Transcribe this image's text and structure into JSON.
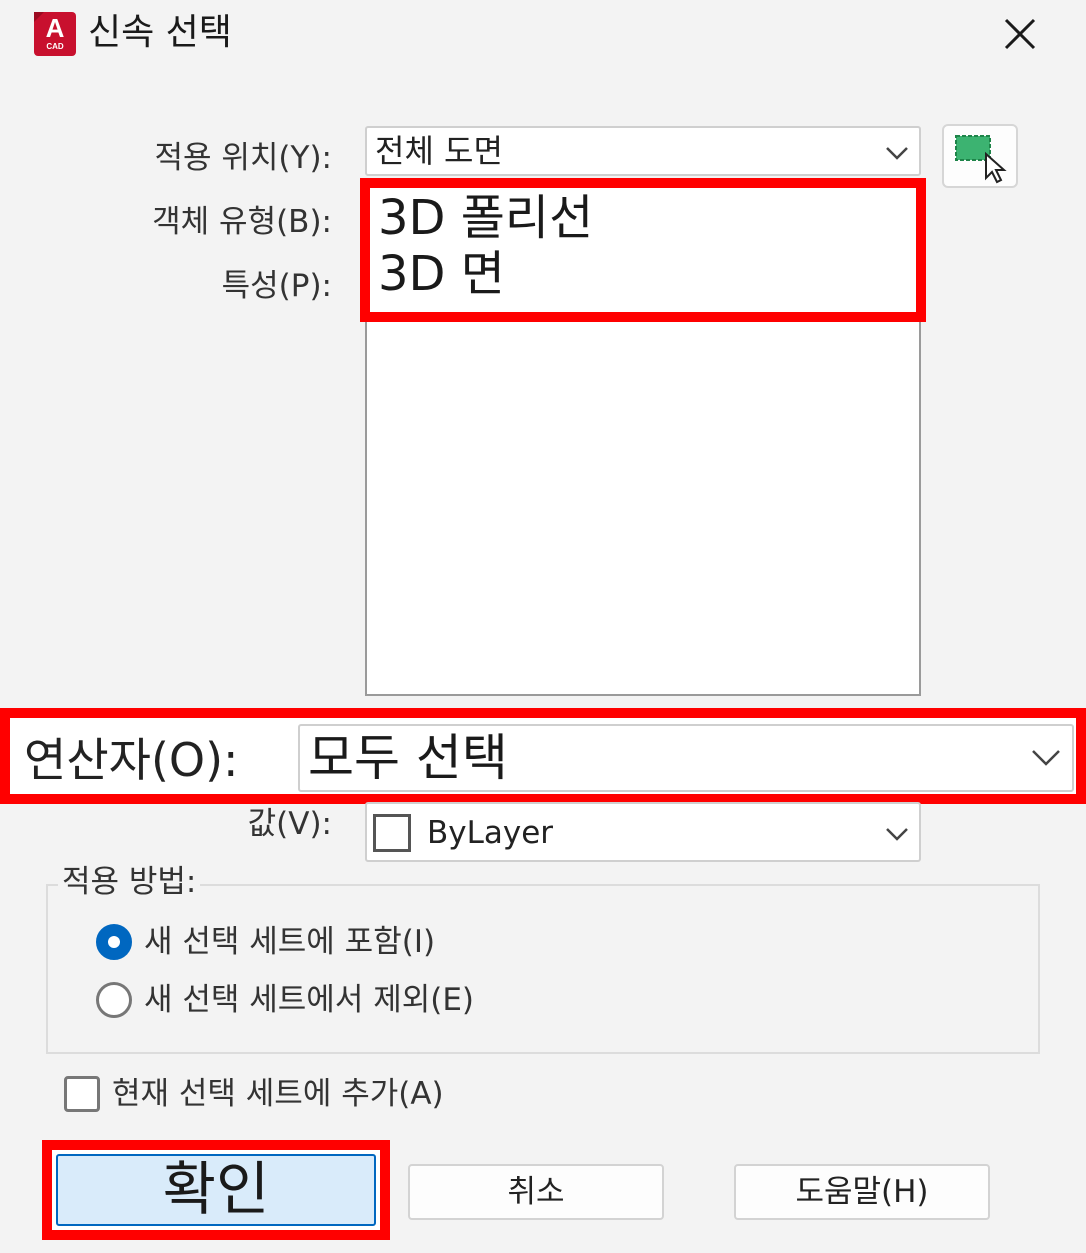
{
  "window": {
    "title": "신속 선택",
    "app_icon": {
      "letter": "A",
      "sub": "CAD",
      "color": "#c8102e"
    }
  },
  "apply_to": {
    "label": "적용 위치(Y):",
    "value": "전체 도면"
  },
  "object_type": {
    "label": "객체 유형(B):",
    "items": [
      "3D 폴리선",
      "3D 면"
    ]
  },
  "properties": {
    "label": "특성(P):"
  },
  "operator": {
    "label": "연산자(O):",
    "value": "모두 선택"
  },
  "value": {
    "label": "값(V):",
    "value": "ByLayer"
  },
  "how_to_apply": {
    "label": "적용 방법:",
    "options": [
      {
        "label": "새 선택 세트에 포함(I)",
        "selected": true
      },
      {
        "label": "새 선택 세트에서 제외(E)",
        "selected": false
      }
    ]
  },
  "append_checkbox": {
    "label": "현재 선택 세트에 추가(A)",
    "checked": false
  },
  "buttons": {
    "ok": "확인",
    "cancel": "취소",
    "help": "도움말(H)"
  },
  "icons": {
    "close": "close-icon",
    "select_objects": "select-objects-icon",
    "dropdown": "chevron-down-icon"
  },
  "colors": {
    "highlight": "#ff0000",
    "accent": "#0067c0",
    "ok_fill": "#d9ebfa"
  }
}
